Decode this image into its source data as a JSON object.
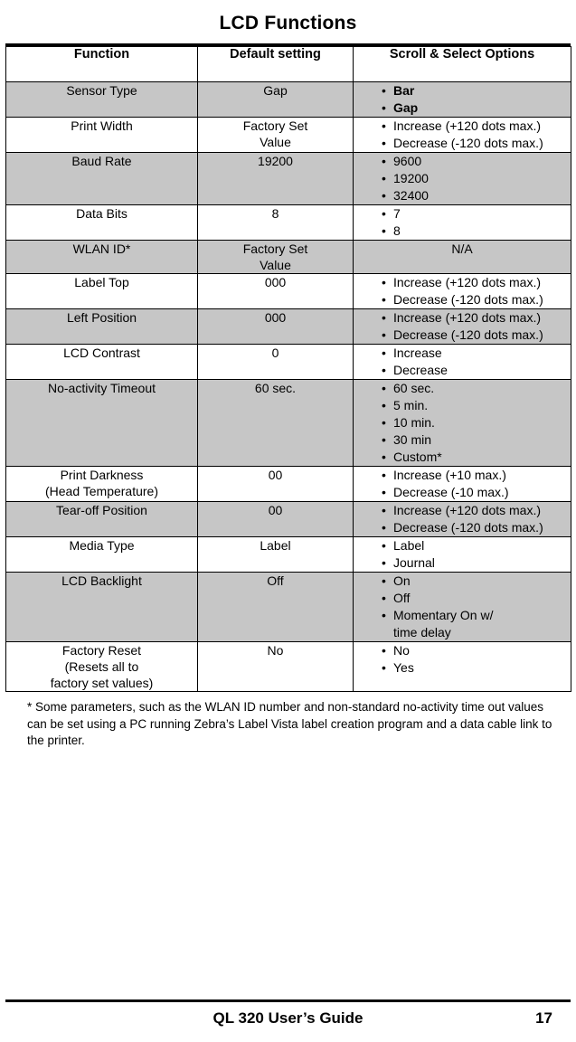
{
  "page": {
    "title": "LCD Functions",
    "footnote": "* Some parameters, such as the WLAN ID number and non-standard no-activity time out values can be set using  a PC running Zebra’s Label Vista label creation program and a data cable  link to the printer.",
    "footer_title": "QL 320 User’s Guide",
    "footer_page": "17"
  },
  "table": {
    "headers": [
      "Function",
      "Default setting",
      "Scroll & Select Options"
    ],
    "rows": [
      {
        "function": "Sensor Type",
        "default": "Gap",
        "options": [
          "Bar",
          "Gap"
        ],
        "options_bold": true,
        "shaded": true
      },
      {
        "function": "Print Width",
        "default": "Factory Set\nValue",
        "options": [
          "Increase (+120 dots max.)",
          "Decrease (-120 dots max.)"
        ],
        "options_bold": false,
        "shaded": false
      },
      {
        "function": "Baud Rate",
        "default": "19200",
        "options": [
          "9600",
          "19200",
          "32400"
        ],
        "options_bold": false,
        "shaded": true
      },
      {
        "function": "Data Bits",
        "default": "8",
        "options": [
          "7",
          "8"
        ],
        "options_bold": false,
        "shaded": false
      },
      {
        "function": "WLAN ID*",
        "default": "Factory Set\nValue",
        "options_plain": "N/A",
        "shaded": true
      },
      {
        "function": "Label Top",
        "default": "000",
        "options": [
          "Increase (+120 dots max.)",
          "Decrease (-120 dots max.)"
        ],
        "options_bold": false,
        "shaded": false
      },
      {
        "function": "Left Position",
        "default": "000",
        "options": [
          "Increase (+120 dots max.)",
          "Decrease (-120 dots max.)"
        ],
        "options_bold": false,
        "shaded": true
      },
      {
        "function": "LCD Contrast",
        "default": "0",
        "options": [
          "Increase",
          "Decrease"
        ],
        "options_bold": false,
        "shaded": false
      },
      {
        "function": "No-activity Timeout",
        "default": "60 sec.",
        "options": [
          "60 sec.",
          "5 min.",
          "10 min.",
          "30 min",
          "Custom*"
        ],
        "options_bold": false,
        "shaded": true
      },
      {
        "function": "Print Darkness\n(Head Temperature)",
        "default": "00",
        "options": [
          "Increase (+10 max.)",
          "Decrease (-10 max.)"
        ],
        "options_bold": false,
        "shaded": false
      },
      {
        "function": "Tear-off Position",
        "default": "00",
        "options": [
          "Increase (+120 dots max.)",
          "Decrease (-120 dots max.)"
        ],
        "options_bold": false,
        "shaded": true
      },
      {
        "function": "Media Type",
        "default": "Label",
        "options": [
          "Label",
          "Journal"
        ],
        "options_bold": false,
        "shaded": false
      },
      {
        "function": "LCD Backlight",
        "default": "Off",
        "options": [
          "On",
          "Off",
          "Momentary On w/",
          "time delay"
        ],
        "options_continuation": [
          false,
          false,
          false,
          true
        ],
        "options_bold": false,
        "shaded": true
      },
      {
        "function": "Factory Reset\n(Resets all to\nfactory set values)",
        "default": "No",
        "options": [
          "No",
          "Yes"
        ],
        "options_bold": false,
        "shaded": false
      }
    ]
  }
}
